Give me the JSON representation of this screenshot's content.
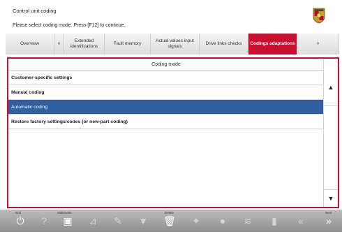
{
  "header": {
    "title": "Control unit coding",
    "instruction": "Please select coding mode. Press [F12] to continue."
  },
  "tabs": [
    {
      "label": "Overview",
      "active": false
    },
    {
      "label": "«",
      "active": false
    },
    {
      "label": "Extended identifications",
      "active": false
    },
    {
      "label": "Fault memory",
      "active": false
    },
    {
      "label": "Actual values input signals",
      "active": false
    },
    {
      "label": "Drive links checks",
      "active": false
    },
    {
      "label": "Codings adaptations",
      "active": true
    },
    {
      "label": "»",
      "active": false
    }
  ],
  "list": {
    "header": "Coding mode",
    "rows": [
      {
        "label": "Customer-specific settings",
        "bold": true,
        "selected": false
      },
      {
        "label": "Manual coding",
        "bold": true,
        "selected": false
      },
      {
        "label": "Automatic coding",
        "bold": false,
        "selected": true
      },
      {
        "label": "Restore factory settings/codes (or new-part coding)",
        "bold": true,
        "selected": false
      }
    ]
  },
  "scrollbar": {
    "up": "▲",
    "down": "▼"
  },
  "toolbar": {
    "end_label": "End",
    "multimeter_label": "Multimeter",
    "delete_label": "Delete",
    "next_label": "Next",
    "buttons": [
      {
        "name": "end-button",
        "icon": "power-icon",
        "glyph": "⏻",
        "enabled": true
      },
      {
        "name": "help-button",
        "icon": "help-icon",
        "glyph": "?",
        "enabled": false
      },
      {
        "name": "multimeter-button",
        "icon": "multimeter-icon",
        "glyph": "▣",
        "enabled": true
      },
      {
        "name": "chart-button",
        "icon": "chart-icon",
        "glyph": "⊿",
        "enabled": false
      },
      {
        "name": "pen-button",
        "icon": "pen-icon",
        "glyph": "✎",
        "enabled": false
      },
      {
        "name": "filter-button",
        "icon": "filter-icon",
        "glyph": "▼",
        "enabled": false
      },
      {
        "name": "delete-button",
        "icon": "trash-icon",
        "glyph": "🗑",
        "enabled": true
      },
      {
        "name": "wrench-button",
        "icon": "wrench-icon",
        "glyph": "✦",
        "enabled": false
      },
      {
        "name": "info-button",
        "icon": "info-icon",
        "glyph": "●",
        "enabled": false
      },
      {
        "name": "signal-button",
        "icon": "signal-icon",
        "glyph": "≋",
        "enabled": false
      },
      {
        "name": "battery-button",
        "icon": "battery-icon",
        "glyph": "▮",
        "enabled": false
      },
      {
        "name": "back-button",
        "icon": "double-left-icon",
        "glyph": "«",
        "enabled": false
      },
      {
        "name": "next-button",
        "icon": "double-right-icon",
        "glyph": "»",
        "enabled": true
      }
    ]
  },
  "colors": {
    "accent": "#c8102e",
    "selection": "#2f5f9e"
  }
}
